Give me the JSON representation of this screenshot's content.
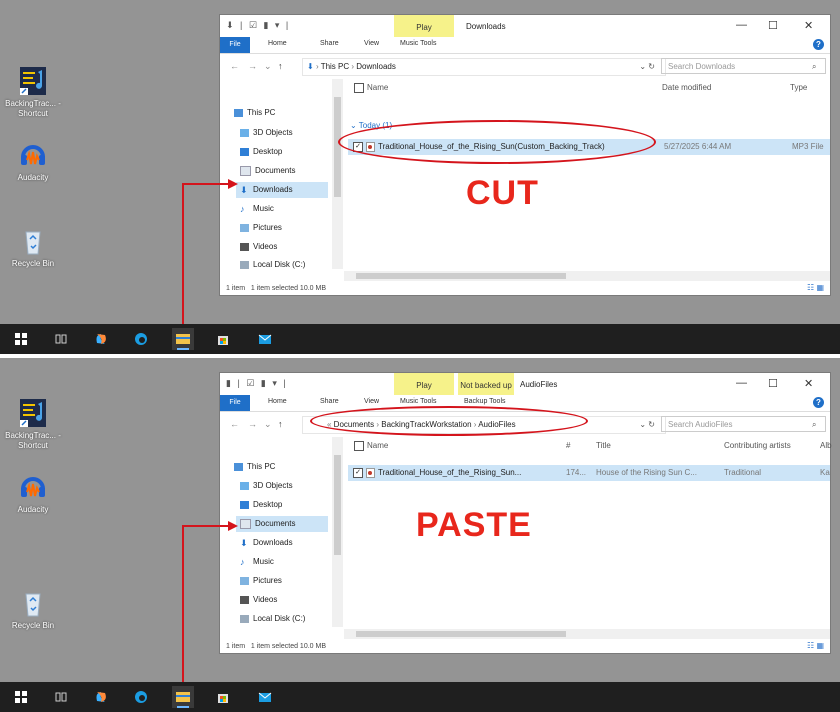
{
  "desktop": {
    "icons": [
      {
        "label": "BackingTrac... - Shortcut",
        "icon": "backing-track-shortcut-icon"
      },
      {
        "label": "Audacity",
        "icon": "audacity-icon"
      },
      {
        "label": "Recycle Bin",
        "icon": "recycle-bin-icon"
      }
    ]
  },
  "panels": {
    "cut": {
      "label": "CUT",
      "window": {
        "title": "Downloads",
        "contextual_tabs": [
          "Play"
        ],
        "contextual_subtabs": [
          "Music Tools"
        ],
        "ribbon_tabs": [
          "File",
          "Home",
          "Share",
          "View"
        ],
        "address": [
          "This PC",
          "Downloads"
        ],
        "search_placeholder": "Search Downloads",
        "columns": [
          "Name",
          "Date modified",
          "Type"
        ],
        "group_label": "Today (1)",
        "file": {
          "name": "Traditional_House_of_the_Rising_Sun(Custom_Backing_Track)",
          "date": "5/27/2025 6:44 AM",
          "type": "MP3 File"
        },
        "status_items": "1 item",
        "status_selected": "1 item selected  10.0 MB"
      }
    },
    "paste": {
      "label": "PASTE",
      "window": {
        "title": "AudioFiles",
        "contextual_tabs": [
          "Play",
          "Not backed up"
        ],
        "contextual_subtabs": [
          "Music Tools",
          "Backup Tools"
        ],
        "ribbon_tabs": [
          "File",
          "Home",
          "Share",
          "View"
        ],
        "address": [
          "Documents",
          "BackingTrackWorkstation",
          "AudioFiles"
        ],
        "search_placeholder": "Search AudioFiles",
        "columns": [
          "Name",
          "#",
          "Title",
          "Contributing artists",
          "Alb"
        ],
        "file": {
          "name": "Traditional_House_of_the_Rising_Sun...",
          "number": "174...",
          "title": "House of the Rising Sun C...",
          "artists": "Traditional",
          "album": "Ka"
        },
        "status_items": "1 item",
        "status_selected": "1 item selected  10.0 MB"
      }
    }
  },
  "nav_items": [
    "This PC",
    "3D Objects",
    "Desktop",
    "Documents",
    "Downloads",
    "Music",
    "Pictures",
    "Videos",
    "Local Disk (C:)"
  ],
  "colors": {
    "accent": "#1f6fc8",
    "annotation": "#d4141c",
    "selection": "#cce4f7",
    "contextual_tab": "#f6f28a"
  }
}
